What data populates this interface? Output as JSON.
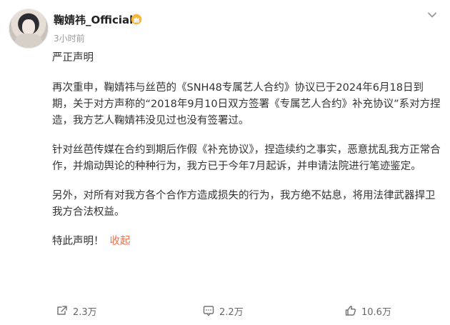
{
  "author": {
    "name": "鞠婧祎_Official",
    "time": "3小时前"
  },
  "post": {
    "title": "严正声明",
    "paragraphs": [
      "再次重申，鞠婧祎与丝芭的《SNH48专属艺人合约》协议已于2024年6月18日到期，关于对方声称的“2018年9月10日双方签署《专属艺人合约》补充协议”系对方捏造，我方艺人鞠婧祎没见过也没有签署过。",
      "针对丝芭传媒在合约到期后作假《补充协议》，捏造续约之事实，恶意扰乱我方正常合作，并煽动舆论的种种行为，我方已于今年7月起诉，并申请法院进行笔迹鉴定。",
      "另外，对所有对我方各个合作方造成损失的行为，我方绝不姑息，将用法律武器捍卫我方合法权益。"
    ],
    "closing": "特此声明！",
    "collapse_label": "收起"
  },
  "actions": {
    "repost_count": "2.3万",
    "comment_count": "2.2万",
    "like_count": "10.6万"
  },
  "colors": {
    "accent": "#eb7350",
    "text": "#333333",
    "muted": "#999999"
  },
  "icons": {
    "verified": "gold-crown-badge-icon",
    "menu": "chevron-down-icon",
    "repost": "repost-icon",
    "comment": "comment-icon",
    "like": "thumbs-up-icon"
  }
}
